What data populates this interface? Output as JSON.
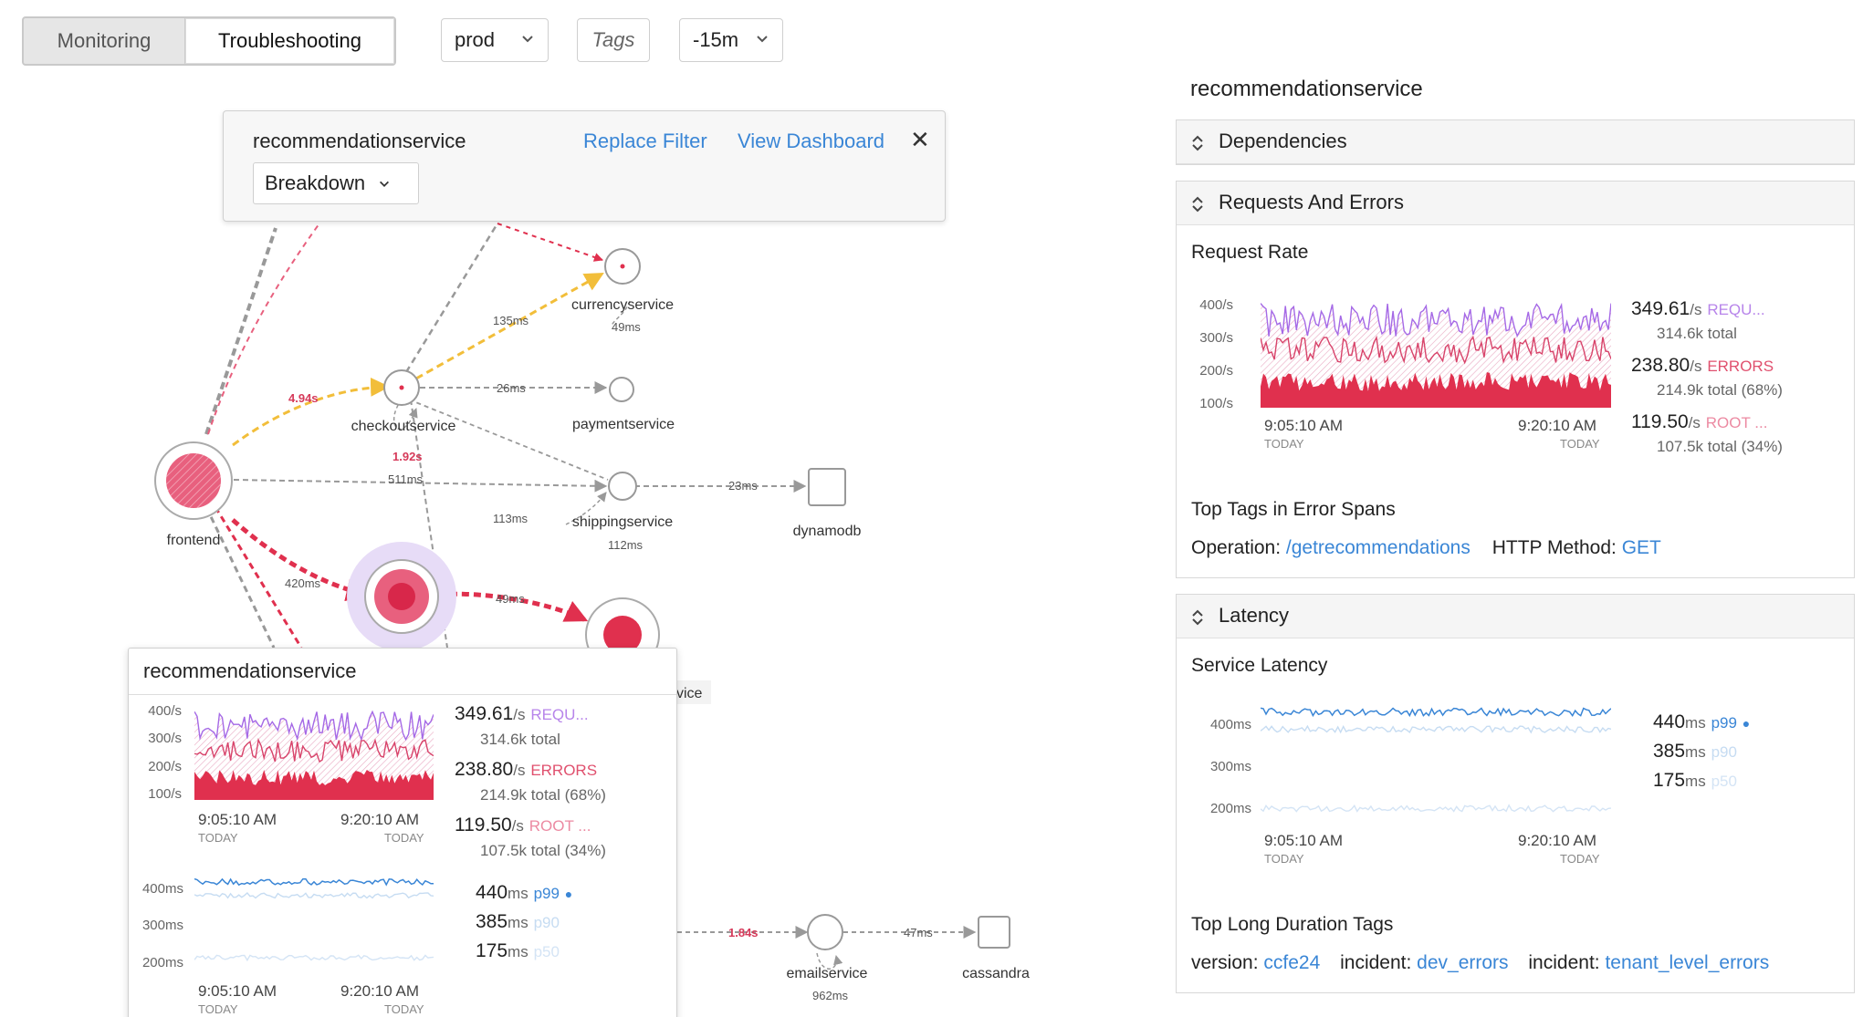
{
  "toolbar": {
    "monitoring_label": "Monitoring",
    "troubleshooting_label": "Troubleshooting",
    "environment": "prod",
    "tags_label": "Tags",
    "time_range": "-15m"
  },
  "popup": {
    "title": "recommendationservice",
    "replace_filter": "Replace Filter",
    "view_dashboard": "View Dashboard",
    "breakdown": "Breakdown"
  },
  "nodes": {
    "currencyservice": "currencyservice",
    "checkoutservice": "checkoutservice",
    "paymentservice": "paymentservice",
    "frontend": "frontend",
    "shippingservice": "shippingservice",
    "dynamodb": "dynamodb",
    "emailservice": "emailservice",
    "cassandra": "cassandra",
    "partial_label": "vice"
  },
  "edges": {
    "e135": "135ms",
    "e49a": "49ms",
    "e494": "4.94s",
    "e26": "26ms",
    "e192": "1.92s",
    "e511": "511ms",
    "e23": "23ms",
    "e113": "113ms",
    "e112": "112ms",
    "e420": "420ms",
    "e49b": "49ms",
    "e184": "1.84s",
    "e47": "47ms",
    "e962": "962ms"
  },
  "tooltip": {
    "title": "recommendationservice",
    "req_axis": [
      "400/s",
      "300/s",
      "200/s",
      "100/s"
    ],
    "lat_axis": [
      "400ms",
      "300ms",
      "200ms"
    ],
    "time_start": "9:05:10 AM",
    "time_end": "9:20:10 AM",
    "today": "TODAY"
  },
  "requests": {
    "rate_value": "349.61",
    "rate_unit": "/s",
    "rate_label": "REQU...",
    "rate_total": "314.6k total",
    "errors_value": "238.80",
    "errors_unit": "/s",
    "errors_label": "ERRORS",
    "errors_total": "214.9k total (68%)",
    "root_value": "119.50",
    "root_unit": "/s",
    "root_label": "ROOT ...",
    "root_total": "107.5k total (34%)"
  },
  "latency": {
    "p99_value": "440",
    "p90_value": "385",
    "p50_value": "175",
    "unit": "ms",
    "p99_label": "p99",
    "p90_label": "p90",
    "p50_label": "p50"
  },
  "panel": {
    "title": "recommendationservice",
    "dependencies": "Dependencies",
    "requests_errors": "Requests And Errors",
    "request_rate": "Request Rate",
    "top_tags_errors": "Top Tags in Error Spans",
    "operation_key": "Operation:",
    "operation_val": "/getrecommendations",
    "http_key": "HTTP Method:",
    "http_val": "GET",
    "latency": "Latency",
    "service_latency": "Service Latency",
    "top_long_tags": "Top Long Duration Tags",
    "version_key": "version:",
    "version_val": "ccfe24",
    "incident_key1": "incident:",
    "incident_val1": "dev_errors",
    "incident_key2": "incident:",
    "incident_val2": "tenant_level_errors"
  },
  "colors": {
    "accent_blue": "#3a86d6",
    "error_red": "#e0304e",
    "request_purple": "#a569e6",
    "root_pink": "#e8607e",
    "warn_yellow": "#f2be3a"
  }
}
